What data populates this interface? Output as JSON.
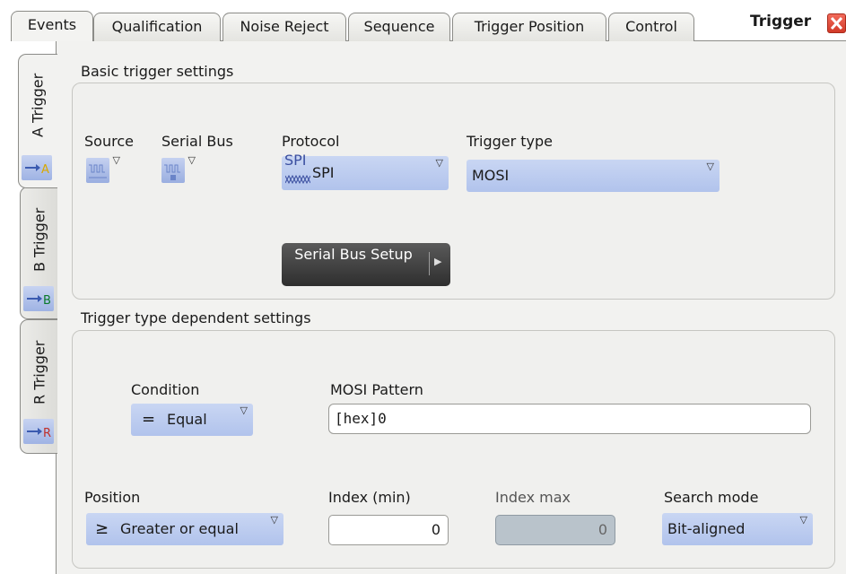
{
  "dialog": {
    "title": "Trigger"
  },
  "top_tabs": [
    {
      "label": "Events"
    },
    {
      "label": "Qualification"
    },
    {
      "label": "Noise Reject"
    },
    {
      "label": "Sequence"
    },
    {
      "label": "Trigger Position"
    },
    {
      "label": "Control"
    }
  ],
  "side_tabs": [
    {
      "label": "A Trigger",
      "icon": "trigger-a-icon",
      "icon_letter": "A"
    },
    {
      "label": "B Trigger",
      "icon": "trigger-b-icon",
      "icon_letter": "B"
    },
    {
      "label": "R Trigger",
      "icon": "trigger-r-icon",
      "icon_letter": "R"
    }
  ],
  "basic": {
    "group_label": "Basic trigger settings",
    "source_label": "Source",
    "serial_bus_label": "Serial Bus",
    "protocol_label": "Protocol",
    "protocol_icon_top": "SPI",
    "protocol_value": "SPI",
    "trigger_type_label": "Trigger type",
    "trigger_type_value": "MOSI",
    "setup_button": "Serial Bus Setup"
  },
  "dependent": {
    "group_label": "Trigger type dependent settings",
    "condition_label": "Condition",
    "condition_symbol": "=",
    "condition_value": "Equal",
    "pattern_label": "MOSI Pattern",
    "pattern_value": "[hex]0",
    "position_label": "Position",
    "position_symbol": "≥",
    "position_value": "Greater or equal",
    "index_min_label": "Index (min)",
    "index_min_value": "0",
    "index_max_label": "Index max",
    "index_max_value": "0",
    "search_mode_label": "Search mode",
    "search_mode_value": "Bit-aligned"
  },
  "colors": {
    "accent": "#b1c3ec",
    "close": "#d23a28",
    "panel": "#f2f2f0"
  }
}
